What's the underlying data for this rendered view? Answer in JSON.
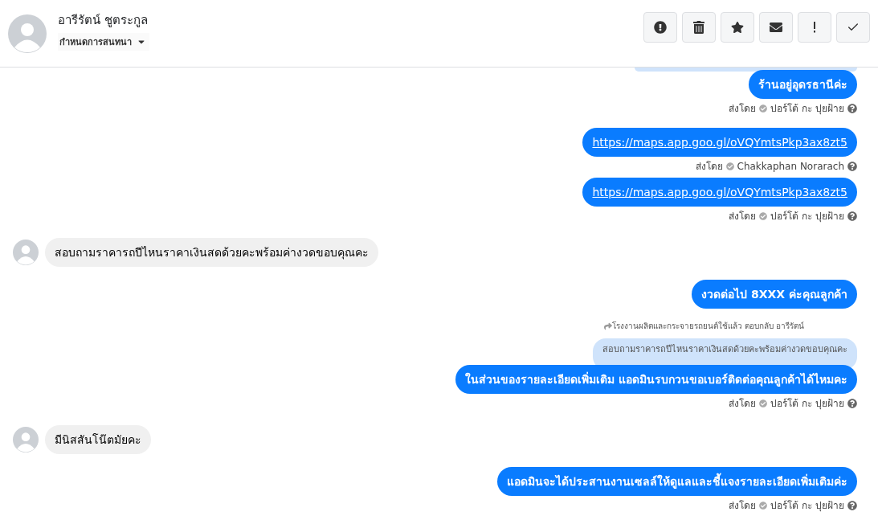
{
  "header": {
    "name": "อารีรัตน์ ชูตระกูล",
    "subtitle": "กำหนดการสนทนา",
    "actions": [
      {
        "kind": "alert"
      },
      {
        "kind": "trash"
      },
      {
        "kind": "star"
      },
      {
        "kind": "mail"
      },
      {
        "kind": "exclaim"
      },
      {
        "kind": "check"
      }
    ]
  },
  "messages": [
    {
      "kind": "cut_preview"
    },
    {
      "kind": "outgoing",
      "text": "ร้านอยู่อุดรธานีค่ะ"
    },
    {
      "kind": "sent_by",
      "label": "ส่งโดย",
      "sender": "ปอร์โต้ กะ ปุยฝ้าย"
    },
    {
      "kind": "outgoing_link",
      "text": "https://maps.app.goo.gl/oVQYmtsPkp3ax8zt5"
    },
    {
      "kind": "sent_by",
      "label": "ส่งโดย",
      "sender": "Chakkaphan Norarach"
    },
    {
      "kind": "outgoing_link",
      "text": "https://maps.app.goo.gl/oVQYmtsPkp3ax8zt5"
    },
    {
      "kind": "sent_by",
      "label": "ส่งโดย",
      "sender": "ปอร์โต้ กะ ปุยฝ้าย"
    },
    {
      "kind": "incoming",
      "text": "สอบถามราคารถปีไหนราคาเงินสดด้วยคะพร้อมค่างวดขอบคุณคะ"
    },
    {
      "kind": "outgoing",
      "text": "งวดต่อไป 8XXX ค่ะคุณลูกค้า"
    },
    {
      "kind": "reply",
      "header": "โรงงานผลิตและกระจายรถยนต์ใช้แล้ว ตอบกลับ อารีรัตน์",
      "quoted": "สอบถามราคารถปีไหนราคาเงินสดด้วยคะพร้อมค่างวดขอบคุณคะ",
      "text": "ในส่วนของรายละเอียดเพิ่มเติม แอดมินรบกวนขอเบอร์ติดต่อคุณลูกค้าได้ไหมคะ"
    },
    {
      "kind": "sent_by",
      "label": "ส่งโดย",
      "sender": "ปอร์โต้ กะ ปุยฝ้าย"
    },
    {
      "kind": "incoming",
      "text": "มีนิสสันโน๊ตมัยคะ"
    },
    {
      "kind": "outgoing",
      "text": "แอดมินจะได้ประสานงานเซลล์ให้ดูแลและชี้แจงรายละเอียดเพิ่มเติมค่ะ"
    },
    {
      "kind": "sent_by",
      "label": "ส่งโดย",
      "sender": "ปอร์โต้ กะ ปุยฝ้าย"
    }
  ]
}
